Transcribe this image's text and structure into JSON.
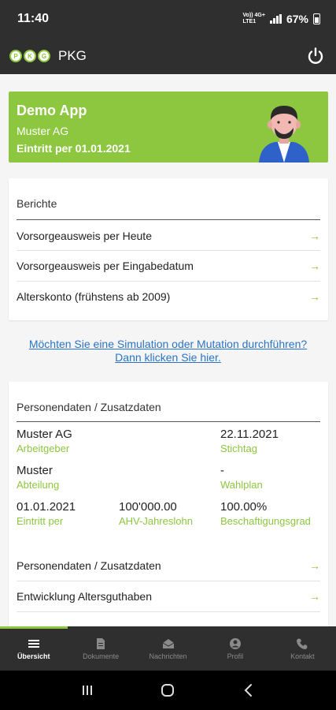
{
  "status": {
    "time": "11:40",
    "network": "Vo)) 4G+\nLTE1",
    "battery": "67%"
  },
  "appbar": {
    "title": "PKG",
    "logo": [
      "P",
      "K",
      "G"
    ]
  },
  "hero": {
    "title": "Demo App",
    "company": "Muster AG",
    "entry": "Eintritt per 01.01.2021"
  },
  "reports": {
    "heading": "Berichte",
    "items": [
      {
        "label": "Vorsorgeausweis per Heute"
      },
      {
        "label": "Vorsorgeausweis per Eingabedatum"
      },
      {
        "label": "Alterskonto (frühstens ab 2009)"
      }
    ]
  },
  "simulation_link": {
    "line1": "Möchten Sie eine Simulation oder Mutation durchführen?",
    "line2": "Dann klicken Sie hier."
  },
  "person": {
    "heading": "Personendaten / Zusatzdaten",
    "employer": {
      "value": "Muster AG",
      "label": "Arbeitgeber"
    },
    "date": {
      "value": "22.11.2021",
      "label": "Stichtag"
    },
    "department": {
      "value": "Muster",
      "label": "Abteilung"
    },
    "plan": {
      "value": "-",
      "label": "Wahlplan"
    },
    "entry": {
      "value": "01.01.2021",
      "label": "Eintritt per"
    },
    "salary": {
      "value": "100'000.00",
      "label": "AHV-Jahreslohn"
    },
    "degree": {
      "value": "100.00%",
      "label": "Beschaftigungsgrad"
    },
    "links": [
      {
        "label": "Personendaten / Zusatzdaten"
      },
      {
        "label": "Entwicklung Altersguthaben"
      }
    ]
  },
  "arrow": "→",
  "nav": {
    "items": [
      {
        "label": "Übersicht",
        "icon": "menu-icon"
      },
      {
        "label": "Dokumente",
        "icon": "document-icon"
      },
      {
        "label": "Nachrichten",
        "icon": "mail-icon"
      },
      {
        "label": "Profil",
        "icon": "person-icon"
      },
      {
        "label": "Kontakt",
        "icon": "phone-icon"
      }
    ]
  },
  "colors": {
    "accent": "#8dc63f",
    "bar": "#2f2f2f",
    "link": "#2a74c5"
  }
}
